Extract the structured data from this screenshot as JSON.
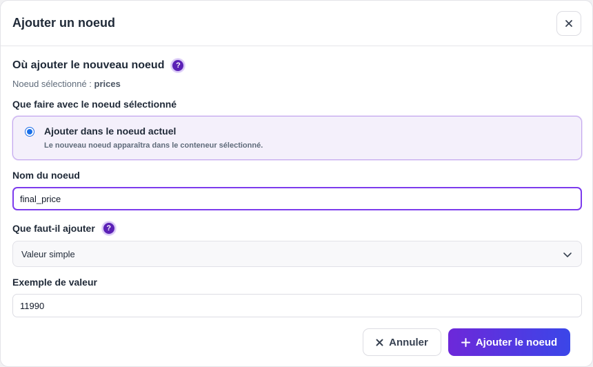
{
  "dialog": {
    "title": "Ajouter un noeud",
    "close_icon": "close-icon"
  },
  "location": {
    "title": "Où ajouter le nouveau noeud",
    "help_glyph": "?",
    "selected_label": "Noeud sélectionné :",
    "selected_value": "prices"
  },
  "action": {
    "label": "Que faire avec le noeud sélectionné",
    "option_title": "Ajouter dans le noeud actuel",
    "option_desc": "Le nouveau noeud apparaîtra dans le conteneur sélectionné.",
    "option_selected": true
  },
  "node_name": {
    "label": "Nom du noeud",
    "value": "final_price"
  },
  "add_type": {
    "label": "Que faut-il ajouter",
    "help_glyph": "?",
    "selected": "Valeur simple"
  },
  "example": {
    "label": "Exemple de valeur",
    "value": "11990"
  },
  "footer": {
    "cancel_label": "Annuler",
    "submit_label": "Ajouter le noeud"
  },
  "colors": {
    "accent": "#6d28d9",
    "accent_end": "#3b46e8",
    "option_bg": "#f4f0fb",
    "radio": "#1a6fe8"
  }
}
